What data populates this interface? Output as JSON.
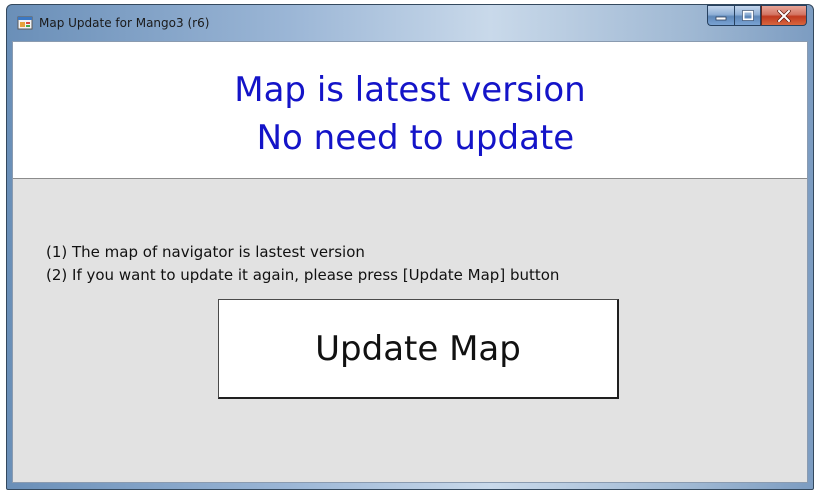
{
  "window": {
    "title": "Map Update for Mango3 (r6)"
  },
  "header": {
    "line1": "Map is latest version",
    "line2": " No need to update"
  },
  "info": {
    "line1": "(1) The map of navigator is lastest version",
    "line2": "(2) If you want to update it again, please press [Update Map] button"
  },
  "buttons": {
    "update_map": "Update Map"
  },
  "icons": {
    "app": "app-window-icon",
    "minimize": "minimize-icon",
    "maximize": "maximize-icon",
    "close": "close-icon"
  },
  "colors": {
    "headline": "#1414c8",
    "client_background": "#e2e2e2",
    "close_button": "#c0391f"
  }
}
